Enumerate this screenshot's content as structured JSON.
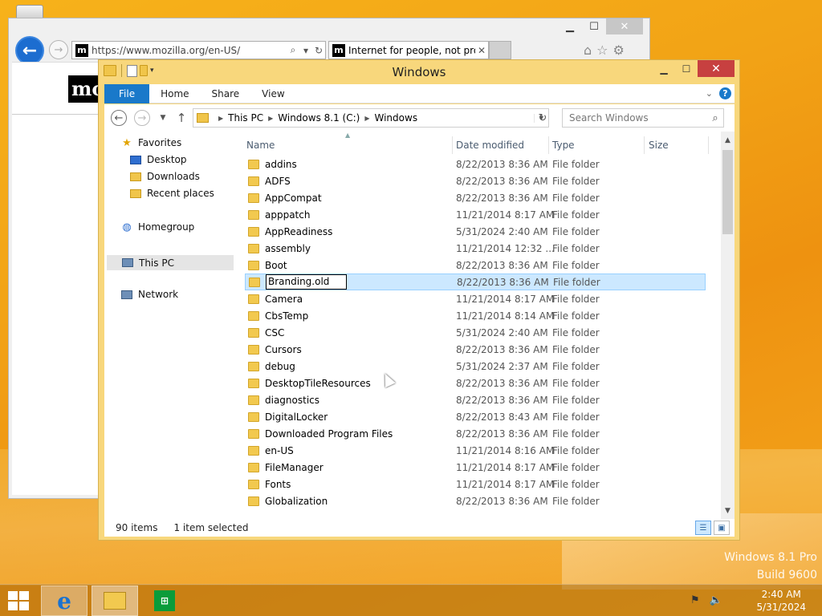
{
  "browser": {
    "url": "https://www.mozilla.org/en-US/",
    "tab_title": "Internet for people, not pro...",
    "logo_text": "mo"
  },
  "explorer": {
    "title": "Windows",
    "ribbon_tabs": [
      "File",
      "Home",
      "Share",
      "View"
    ],
    "breadcrumb": [
      "This PC",
      "Windows 8.1 (C:)",
      "Windows"
    ],
    "search_placeholder": "Search Windows",
    "nav": {
      "favorites": "Favorites",
      "desktop": "Desktop",
      "downloads": "Downloads",
      "recent": "Recent places",
      "homegroup": "Homegroup",
      "thispc": "This PC",
      "network": "Network"
    },
    "columns": [
      "Name",
      "Date modified",
      "Type",
      "Size"
    ],
    "rows": [
      {
        "name": "addins",
        "date": "8/22/2013 8:36 AM",
        "type": "File folder"
      },
      {
        "name": "ADFS",
        "date": "8/22/2013 8:36 AM",
        "type": "File folder"
      },
      {
        "name": "AppCompat",
        "date": "8/22/2013 8:36 AM",
        "type": "File folder"
      },
      {
        "name": "apppatch",
        "date": "11/21/2014 8:17 AM",
        "type": "File folder"
      },
      {
        "name": "AppReadiness",
        "date": "5/31/2024 2:40 AM",
        "type": "File folder"
      },
      {
        "name": "assembly",
        "date": "11/21/2014 12:32 ...",
        "type": "File folder"
      },
      {
        "name": "Boot",
        "date": "8/22/2013 8:36 AM",
        "type": "File folder"
      },
      {
        "name": "Branding.old",
        "date": "8/22/2013 8:36 AM",
        "type": "File folder"
      },
      {
        "name": "Camera",
        "date": "11/21/2014 8:17 AM",
        "type": "File folder"
      },
      {
        "name": "CbsTemp",
        "date": "11/21/2014 8:14 AM",
        "type": "File folder"
      },
      {
        "name": "CSC",
        "date": "5/31/2024 2:40 AM",
        "type": "File folder"
      },
      {
        "name": "Cursors",
        "date": "8/22/2013 8:36 AM",
        "type": "File folder"
      },
      {
        "name": "debug",
        "date": "5/31/2024 2:37 AM",
        "type": "File folder"
      },
      {
        "name": "DesktopTileResources",
        "date": "8/22/2013 8:36 AM",
        "type": "File folder"
      },
      {
        "name": "diagnostics",
        "date": "8/22/2013 8:36 AM",
        "type": "File folder"
      },
      {
        "name": "DigitalLocker",
        "date": "8/22/2013 8:43 AM",
        "type": "File folder"
      },
      {
        "name": "Downloaded Program Files",
        "date": "8/22/2013 8:36 AM",
        "type": "File folder"
      },
      {
        "name": "en-US",
        "date": "11/21/2014 8:16 AM",
        "type": "File folder"
      },
      {
        "name": "FileManager",
        "date": "11/21/2014 8:17 AM",
        "type": "File folder"
      },
      {
        "name": "Fonts",
        "date": "11/21/2014 8:17 AM",
        "type": "File folder"
      },
      {
        "name": "Globalization",
        "date": "8/22/2013 8:36 AM",
        "type": "File folder"
      }
    ],
    "status": {
      "count": "90 items",
      "selected": "1 item selected"
    }
  },
  "watermark": {
    "line1": "Windows 8.1 Pro",
    "line2": "Build 9600"
  },
  "clock": {
    "time": "2:40 AM",
    "date": "5/31/2024"
  }
}
